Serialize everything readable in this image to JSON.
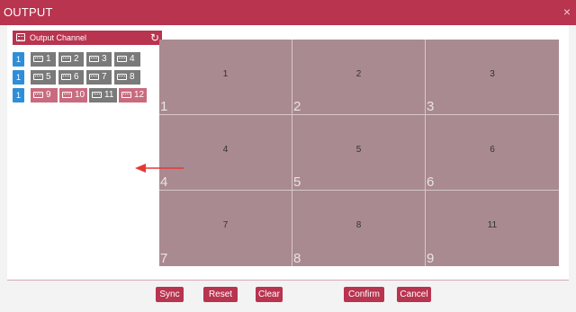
{
  "window": {
    "title": "OUTPUT",
    "close_glyph": "×"
  },
  "panel": {
    "title": "Output Channel",
    "icon": "keyboard-icon",
    "refresh_glyph": "↻"
  },
  "channel_rows": [
    {
      "badge": "1",
      "channels": [
        {
          "label": "1",
          "state": "grey"
        },
        {
          "label": "2",
          "state": "grey"
        },
        {
          "label": "3",
          "state": "grey"
        },
        {
          "label": "4",
          "state": "grey"
        }
      ]
    },
    {
      "badge": "1",
      "channels": [
        {
          "label": "5",
          "state": "grey"
        },
        {
          "label": "6",
          "state": "grey"
        },
        {
          "label": "7",
          "state": "grey"
        },
        {
          "label": "8",
          "state": "grey"
        }
      ]
    },
    {
      "badge": "1",
      "channels": [
        {
          "label": "9",
          "state": "pink"
        },
        {
          "label": "10",
          "state": "pink"
        },
        {
          "label": "11",
          "state": "grey"
        },
        {
          "label": "12",
          "state": "pink"
        }
      ]
    }
  ],
  "grid_cells": [
    {
      "center": "1",
      "corner": "1"
    },
    {
      "center": "2",
      "corner": "2"
    },
    {
      "center": "3",
      "corner": "3"
    },
    {
      "center": "4",
      "corner": "4"
    },
    {
      "center": "5",
      "corner": "5"
    },
    {
      "center": "6",
      "corner": "6"
    },
    {
      "center": "7",
      "corner": "7"
    },
    {
      "center": "8",
      "corner": "8"
    },
    {
      "center": "11",
      "corner": "9"
    }
  ],
  "buttons": {
    "sync": "Sync",
    "reset": "Reset",
    "clear": "Clear",
    "confirm": "Confirm",
    "cancel": "Cancel"
  },
  "colors": {
    "accent": "#b8344f",
    "badge": "#2e8fd8",
    "channel_inactive": "#7a7a7a",
    "channel_active": "#c96b7f",
    "grid_fill": "#a98a90",
    "arrow": "#e53935"
  }
}
